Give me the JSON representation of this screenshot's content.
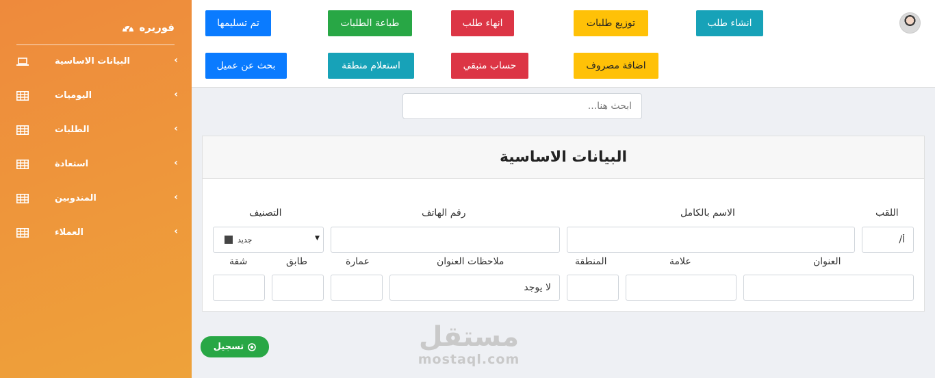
{
  "sidebar": {
    "brand": "فوريره",
    "items": [
      {
        "label": "البيانات الاساسية",
        "icon": "laptop-icon"
      },
      {
        "label": "اليوميات",
        "icon": "table-icon"
      },
      {
        "label": "الطلبات",
        "icon": "table-icon"
      },
      {
        "label": "استعادة",
        "icon": "table-icon"
      },
      {
        "label": "المندوبين",
        "icon": "table-icon"
      },
      {
        "label": "العملاء",
        "icon": "table-icon"
      }
    ]
  },
  "toolbar": {
    "row1": [
      "انشاء طلب",
      "توزيع طلبات",
      "انهاء طلب",
      "طباعة الطلبات",
      "تم تسليمها"
    ],
    "row2": [
      "اضافة مصروف",
      "حساب متبقي",
      "استعلام منطقة",
      "بحث عن عميل"
    ]
  },
  "search": {
    "placeholder": "ابحث هنا..."
  },
  "form": {
    "title": "البيانات الاساسية",
    "labels": {
      "title": "اللقب",
      "full_name": "الاسم بالكامل",
      "phone": "رقم الهاتف",
      "category": "التصنيف",
      "address": "العنوان",
      "landmark": "علامة",
      "area": "المنطقة",
      "address_notes": "ملاحظات العنوان",
      "building": "عمارة",
      "floor": "طابق",
      "apartment": "شقة"
    },
    "values": {
      "title": "أ/",
      "address_notes": "لا يوجد",
      "category": "جديد"
    },
    "submit": "تسجيل"
  },
  "watermark": {
    "ar": "مستقل",
    "en": "mostaql.com"
  },
  "colors": {
    "sidebar": "#ee8a3c",
    "blue": "#0a7bff",
    "green": "#28a745",
    "red": "#dc3545",
    "yellow": "#ffc107",
    "teal": "#17a2b8"
  }
}
